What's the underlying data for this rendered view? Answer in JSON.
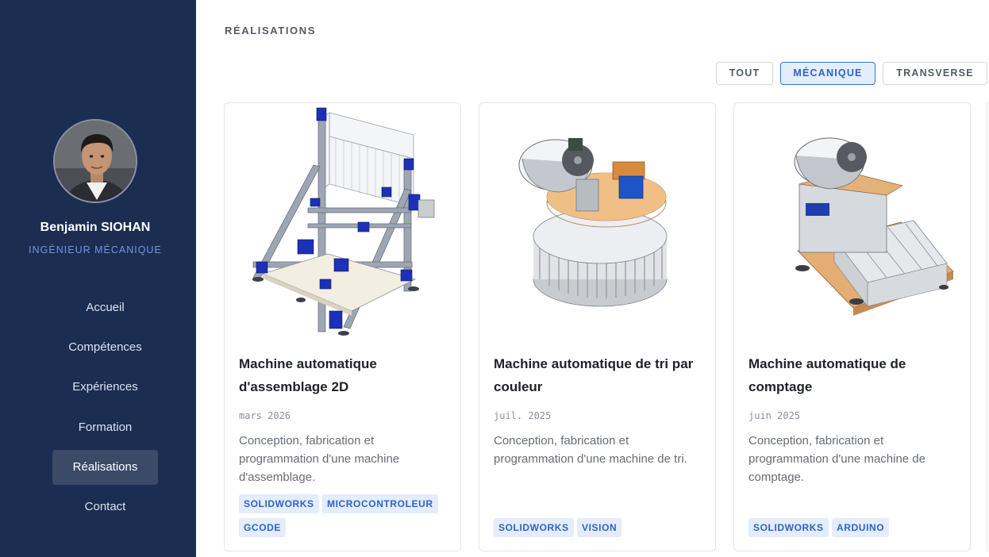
{
  "profile": {
    "name": "Benjamin SIOHAN",
    "role": "INGÉNIEUR MÉCANIQUE"
  },
  "nav": {
    "items": [
      {
        "label": "Accueil"
      },
      {
        "label": "Compétences"
      },
      {
        "label": "Expériences"
      },
      {
        "label": "Formation"
      },
      {
        "label": "Réalisations",
        "active": true
      },
      {
        "label": "Contact"
      }
    ]
  },
  "main": {
    "section_title": "RÉALISATIONS",
    "filters": [
      {
        "label": "TOUT"
      },
      {
        "label": "MÉCANIQUE",
        "active": true
      },
      {
        "label": "TRANSVERSE"
      }
    ],
    "cards": [
      {
        "title": "Machine automatique d'assemblage 2D",
        "date": "mars 2026",
        "description": "Conception, fabrication et programmation d'une machine d'assemblage.",
        "tags": [
          "SOLIDWORKS",
          "MICROCONTROLEUR",
          "GCODE"
        ]
      },
      {
        "title": "Machine automatique de tri par couleur",
        "date": "juil. 2025",
        "description": "Conception, fabrication et programmation d'une machine de tri.",
        "tags": [
          "SOLIDWORKS",
          "VISION"
        ]
      },
      {
        "title": "Machine automatique de comptage",
        "date": "juin 2025",
        "description": "Conception, fabrication et programmation d'une machine de comptage.",
        "tags": [
          "SOLIDWORKS",
          "ARDUINO"
        ]
      }
    ]
  },
  "colors": {
    "sidebar_bg": "#1b2d50",
    "accent": "#2e62c9",
    "tag_bg": "#e4edfc"
  }
}
